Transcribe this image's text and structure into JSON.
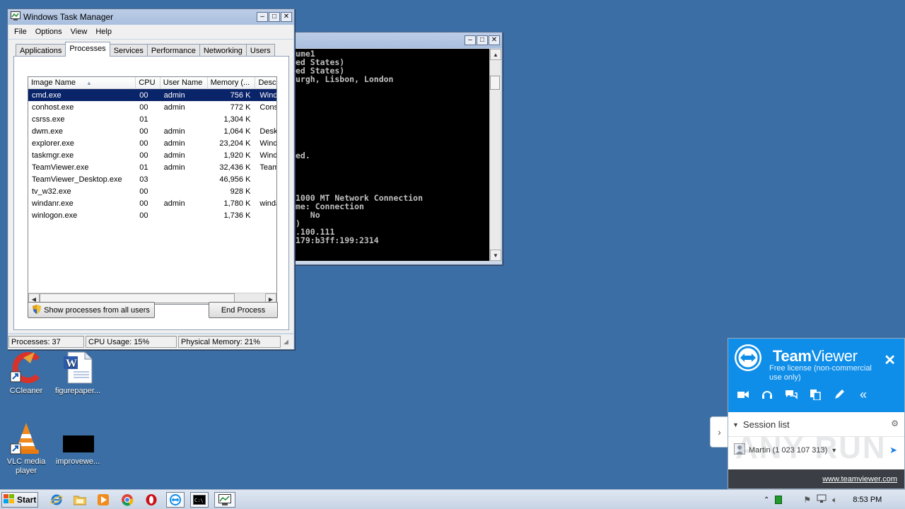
{
  "cmd_window": {
    "lines": [
      "ume1",
      "ed States)",
      "ed States)",
      "urgh, Lisbon, London",
      "",
      "",
      "",
      "",
      "",
      "",
      "",
      "",
      "ed.",
      "",
      "",
      "",
      "",
      "1000 MT Network Connection",
      "me: Connection",
      "   No",
      ")",
      ".100.111",
      "179:b3ff:199:2314"
    ],
    "minimize": "‒",
    "maximize": "□",
    "close": "✕"
  },
  "task_manager": {
    "title": "Windows Task Manager",
    "menu": [
      "File",
      "Options",
      "View",
      "Help"
    ],
    "tabs": [
      "Applications",
      "Processes",
      "Services",
      "Performance",
      "Networking",
      "Users"
    ],
    "active_tab": "Processes",
    "columns": [
      "Image Name",
      "CPU",
      "User Name",
      "Memory (...",
      "Desc"
    ],
    "sort_indicator": "▲",
    "rows": [
      {
        "name": "cmd.exe",
        "cpu": "00",
        "user": "admin",
        "mem": "756 K",
        "desc": "Wind",
        "selected": true
      },
      {
        "name": "conhost.exe",
        "cpu": "00",
        "user": "admin",
        "mem": "772 K",
        "desc": "Cons"
      },
      {
        "name": "csrss.exe",
        "cpu": "01",
        "user": "",
        "mem": "1,304 K",
        "desc": ""
      },
      {
        "name": "dwm.exe",
        "cpu": "00",
        "user": "admin",
        "mem": "1,064 K",
        "desc": "Desk"
      },
      {
        "name": "explorer.exe",
        "cpu": "00",
        "user": "admin",
        "mem": "23,204 K",
        "desc": "Wind"
      },
      {
        "name": "taskmgr.exe",
        "cpu": "00",
        "user": "admin",
        "mem": "1,920 K",
        "desc": "Wind"
      },
      {
        "name": "TeamViewer.exe",
        "cpu": "01",
        "user": "admin",
        "mem": "32,436 K",
        "desc": "Team"
      },
      {
        "name": "TeamViewer_Desktop.exe",
        "cpu": "03",
        "user": "",
        "mem": "46,956 K",
        "desc": ""
      },
      {
        "name": "tv_w32.exe",
        "cpu": "00",
        "user": "",
        "mem": "928 K",
        "desc": ""
      },
      {
        "name": "windanr.exe",
        "cpu": "00",
        "user": "admin",
        "mem": "1,780 K",
        "desc": "winda"
      },
      {
        "name": "winlogon.exe",
        "cpu": "00",
        "user": "",
        "mem": "1,736 K",
        "desc": ""
      }
    ],
    "show_all_button": "Show processes from all users",
    "end_process_button": "End Process",
    "status": {
      "processes": "Processes: 37",
      "cpu": "CPU Usage: 15%",
      "memory": "Physical Memory: 21%"
    }
  },
  "desktop_icons": [
    {
      "label": "CCleaner",
      "icon": "ccleaner-icon"
    },
    {
      "label": "figurepaper...",
      "icon": "word-document-icon"
    },
    {
      "label": "VLC media player",
      "icon": "vlc-icon"
    },
    {
      "label": "improvewe...",
      "icon": "blank-file-icon"
    }
  ],
  "teamviewer": {
    "brand_bold": "Team",
    "brand_light": "Viewer",
    "license": "Free license (non-commercial use only)",
    "close": "✕",
    "session_list_label": "Session list",
    "session_entry": "Martin (1 023 107 313)",
    "link": "www.teamviewer.com",
    "accent": "#0e8ee9"
  },
  "taskbar": {
    "start_label": "Start",
    "clock": "8:53 PM",
    "pinned": [
      "internet-explorer-icon",
      "explorer-folder-icon",
      "media-player-icon",
      "chrome-icon",
      "opera-icon",
      "teamviewer-icon",
      "cmd-icon",
      "task-manager-icon"
    ]
  },
  "watermark": "ANY RUN"
}
